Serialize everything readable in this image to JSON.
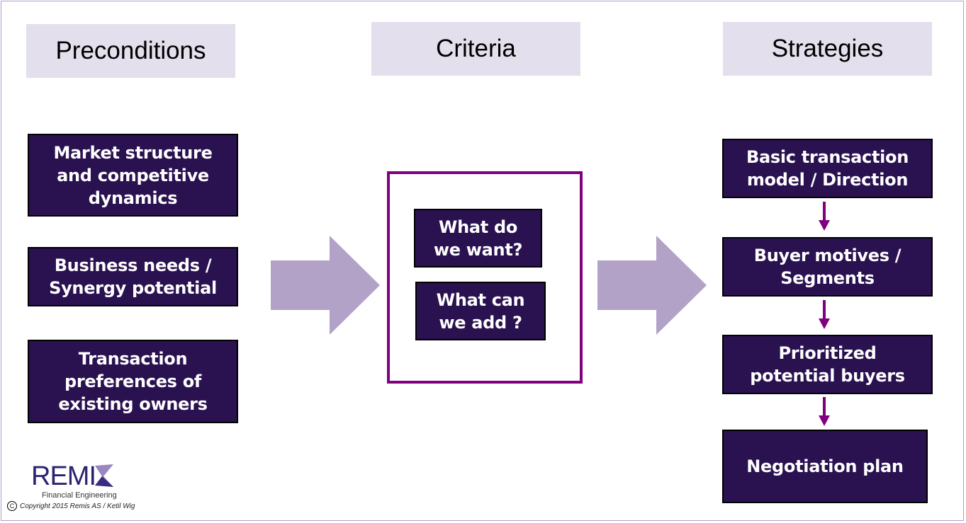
{
  "headers": {
    "preconditions": "Preconditions",
    "criteria": "Criteria",
    "strategies": "Strategies"
  },
  "preconditions": [
    "Market structure and competitive dynamics",
    "Business needs / Synergy potential",
    "Transaction preferences of existing owners"
  ],
  "criteria": [
    "What do we want?",
    "What can we add ?"
  ],
  "strategies": [
    "Basic transaction model / Direction",
    "Buyer motives / Segments",
    "Prioritized potential buyers",
    "Negotiation plan"
  ],
  "logo": {
    "name": "REMIS",
    "name_text": "REMI",
    "tagline": "Financial Engineering"
  },
  "copyright": {
    "symbol": "C",
    "text": "Copyright  2015 Remis AS / Ketil Wig"
  },
  "colors": {
    "box_fill": "#2a1150",
    "header_fill": "#e4dfec",
    "big_arrow": "#b3a2c7",
    "small_arrow": "#800080",
    "criteria_border": "#800080"
  }
}
